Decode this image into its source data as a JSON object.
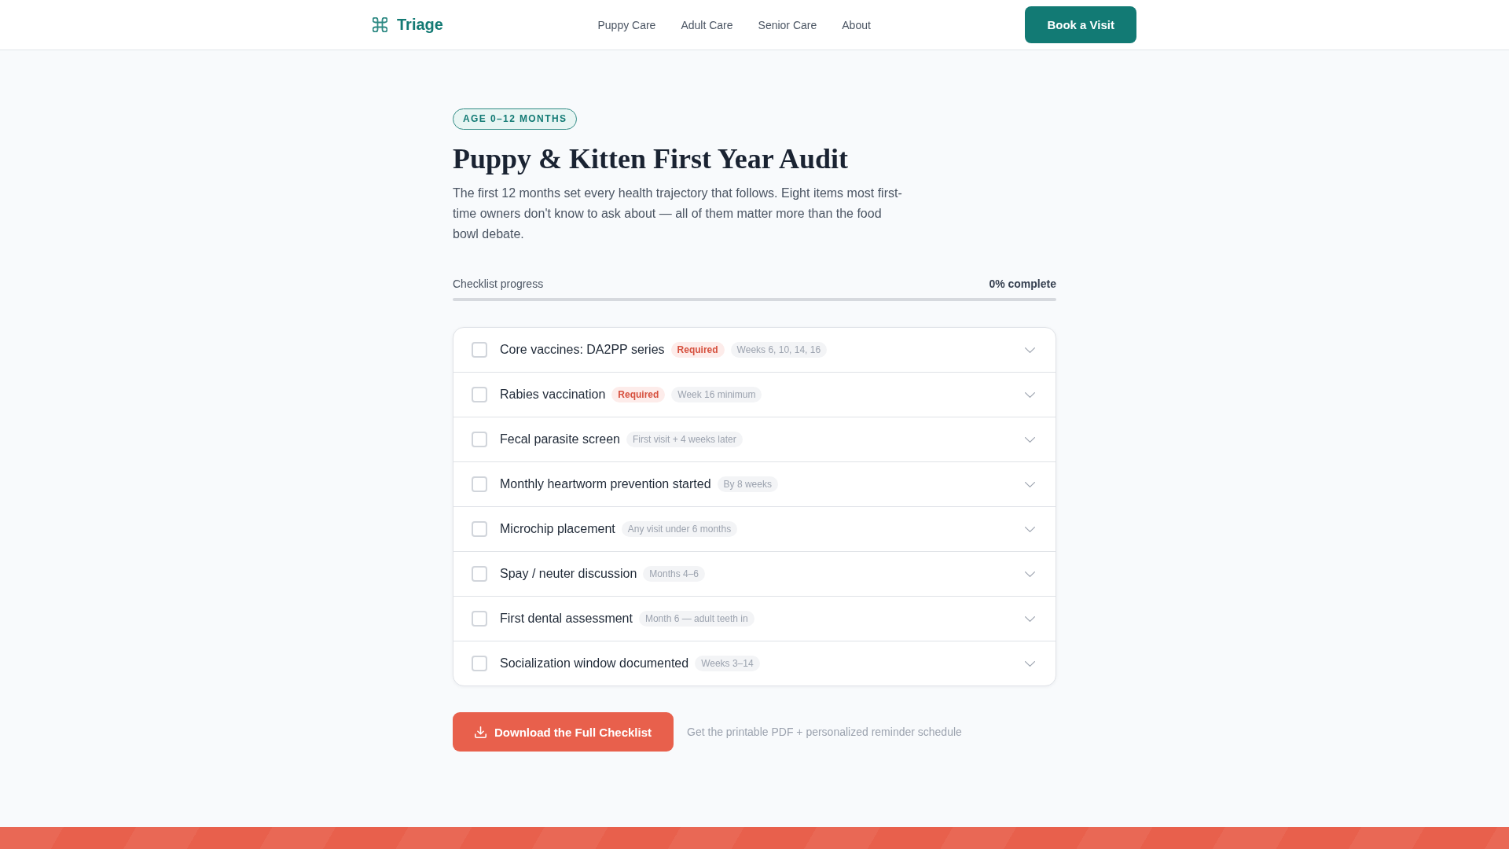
{
  "header": {
    "logo": "Triage",
    "nav": [
      {
        "label": "Puppy Care"
      },
      {
        "label": "Adult Care"
      },
      {
        "label": "Senior Care"
      },
      {
        "label": "About"
      }
    ],
    "cta": "Book a Visit"
  },
  "hero": {
    "badge": "AGE 0–12 MONTHS",
    "title": "Puppy & Kitten First Year Audit",
    "intro": "The first 12 months set every health trajectory that follows. Eight items most first-time owners don't know to ask about — all of them matter more than the food bowl debate."
  },
  "progress": {
    "label": "Checklist progress",
    "reading": "0% complete",
    "level": 0
  },
  "checklist": [
    {
      "title": "Core vaccines: DA2PP series",
      "checked": false,
      "expanded": false,
      "tags": [
        {
          "kind": "required",
          "label": "Required"
        },
        {
          "kind": "timing",
          "label": "Weeks 6, 10, 14, 16"
        }
      ]
    },
    {
      "title": "Rabies vaccination",
      "checked": false,
      "expanded": false,
      "tags": [
        {
          "kind": "required",
          "label": "Required"
        },
        {
          "kind": "timing",
          "label": "Week 16 minimum"
        }
      ]
    },
    {
      "title": "Fecal parasite screen",
      "checked": false,
      "expanded": false,
      "tags": [
        {
          "kind": "timing",
          "label": "First visit + 4 weeks later"
        }
      ]
    },
    {
      "title": "Monthly heartworm prevention started",
      "checked": false,
      "expanded": false,
      "tags": [
        {
          "kind": "timing",
          "label": "By 8 weeks"
        }
      ]
    },
    {
      "title": "Microchip placement",
      "checked": false,
      "expanded": false,
      "tags": [
        {
          "kind": "timing",
          "label": "Any visit under 6 months"
        }
      ]
    },
    {
      "title": "Spay / neuter discussion",
      "checked": false,
      "expanded": false,
      "tags": [
        {
          "kind": "timing",
          "label": "Months 4–6"
        }
      ]
    },
    {
      "title": "First dental assessment",
      "checked": false,
      "expanded": false,
      "tags": [
        {
          "kind": "timing",
          "label": "Month 6 — adult teeth in"
        }
      ]
    },
    {
      "title": "Socialization window documented",
      "checked": false,
      "expanded": false,
      "tags": [
        {
          "kind": "timing",
          "label": "Weeks 3–14"
        }
      ]
    }
  ],
  "download": {
    "button": "Download the Full Checklist",
    "note": "Get the printable PDF + personalized reminder schedule"
  }
}
